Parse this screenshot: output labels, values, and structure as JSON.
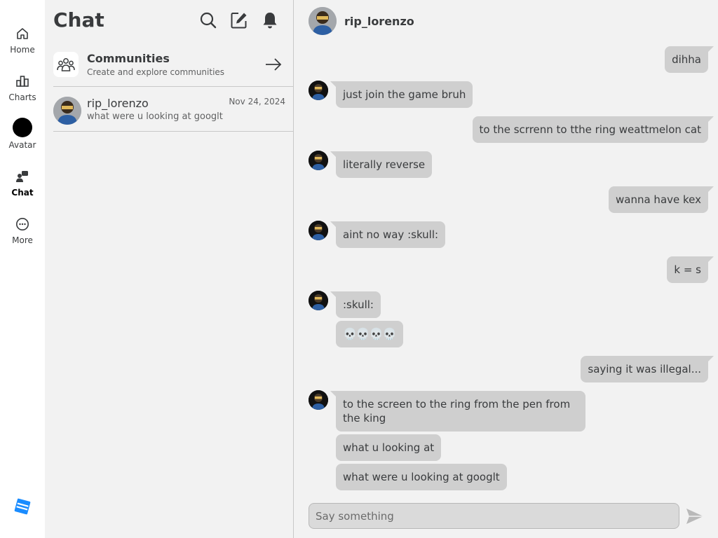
{
  "nav": {
    "items": [
      {
        "label": "Home",
        "icon": "home-icon"
      },
      {
        "label": "Charts",
        "icon": "charts-icon"
      },
      {
        "label": "Avatar",
        "icon": "avatar-icon"
      },
      {
        "label": "Chat",
        "icon": "chat-icon",
        "active": true
      },
      {
        "label": "More",
        "icon": "more-icon"
      }
    ],
    "brand_icon": "roblox-logo-icon",
    "brand_color": "#1a8cff"
  },
  "chat_list": {
    "title": "Chat",
    "actions": [
      "search-icon",
      "compose-icon",
      "bell-icon"
    ],
    "communities": {
      "title": "Communities",
      "subtitle": "Create and explore communities"
    },
    "conversations": [
      {
        "name": "rip_lorenzo",
        "date": "Nov 24, 2024",
        "preview": "what were u looking at googlt"
      }
    ]
  },
  "conversation": {
    "contact": "rip_lorenzo",
    "messages": [
      {
        "dir": "out",
        "text": "dihha"
      },
      {
        "dir": "in",
        "text": "just join the game bruh"
      },
      {
        "dir": "out",
        "text": "to the scrrenn to tthe ring weattmelon cat"
      },
      {
        "dir": "in",
        "text": "literally reverse"
      },
      {
        "dir": "out",
        "text": "wanna have kex"
      },
      {
        "dir": "in",
        "text": "aint no way :skull:"
      },
      {
        "dir": "out",
        "text": "k = s"
      },
      {
        "dir": "in",
        "text": ":skull:"
      },
      {
        "dir": "in",
        "text": "💀💀💀💀"
      },
      {
        "dir": "out",
        "text": "saying it was illegal..."
      },
      {
        "dir": "in",
        "text": "to the screen to the ring from the pen from the king"
      },
      {
        "dir": "in",
        "text": "what u looking at"
      },
      {
        "dir": "in",
        "text": "what were u looking at googlt"
      }
    ],
    "input_placeholder": "Say something"
  },
  "colors": {
    "bubble": "#cfcfcf",
    "page_bg": "#f2f2f2",
    "text": "#393b3d"
  }
}
